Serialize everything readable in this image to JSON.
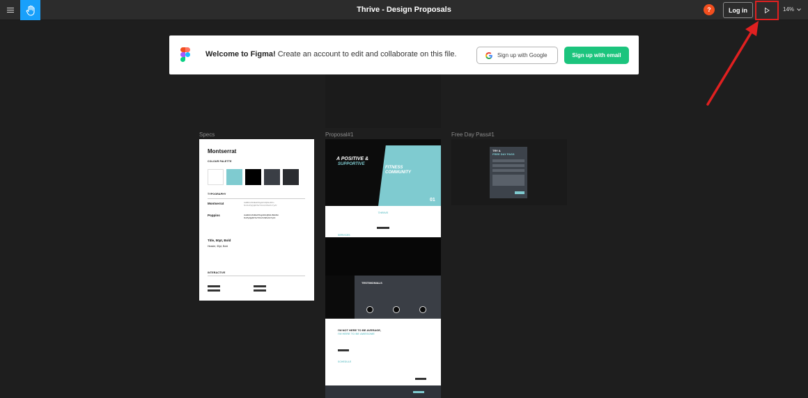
{
  "topbar": {
    "title": "Thrive - Design Proposals",
    "help_label": "?",
    "login_label": "Log in",
    "zoom": "14%"
  },
  "banner": {
    "bold_text": "Welcome to Figma!",
    "text": " Create an account to edit and collaborate on this file.",
    "google_button": "Sign up with Google",
    "email_button": "Sign up with email"
  },
  "frames": {
    "specs_label": "Specs",
    "proposal_label": "Proposal#1",
    "freepass_label": "Free Day Pass#1"
  },
  "specs": {
    "font_name": "Montserrat",
    "colour_palette": "COLOUR PALETTE",
    "typography": "TYPOGRAPHY",
    "font1": "Montserrat",
    "font2": "Poppins",
    "sample1": "Title, 50pt, Bold",
    "sample2": "Header, 30pt, Bold",
    "interactive": "INTERACTIVE",
    "colors": [
      "#ffffff",
      "#7fcbd0",
      "#000000",
      "#3a3e45",
      "#2a2c30"
    ]
  },
  "proposal": {
    "hero_line1": "A POSITIVE &",
    "hero_line2": "SUPPORTIVE",
    "hero_line3": "FITNESS",
    "hero_line4": "COMMUNITY",
    "hero_number": "01",
    "thrive": "THRIVE",
    "services": "SERVICES",
    "testimonials": "TESTIMONIALS",
    "average_line1": "I'M NOT HERE TO BE AVERAGE,",
    "average_line2": "I'M HERE TO BE AWESOME",
    "schedule": "SCHEDULE"
  },
  "freepass": {
    "title_line1": "TRY A",
    "title_line2": "FREE DAY PASS"
  }
}
